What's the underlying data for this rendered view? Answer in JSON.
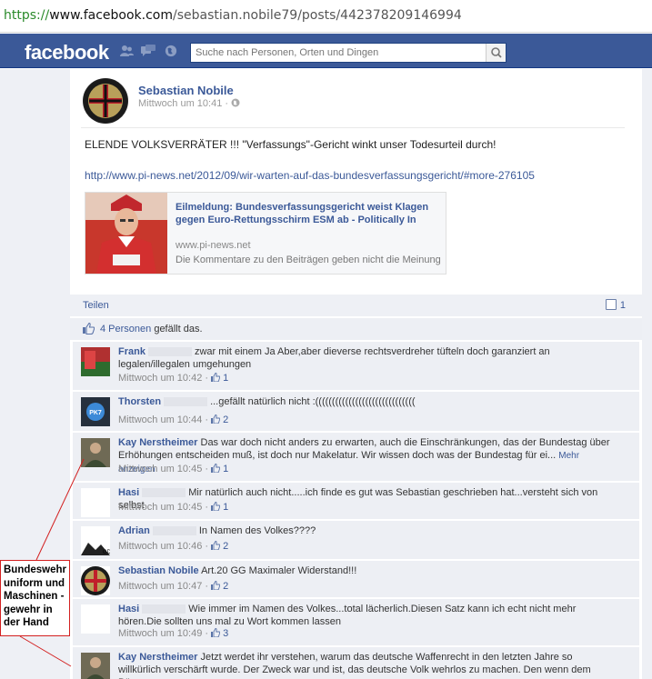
{
  "browser": {
    "url_protocol": "https://",
    "url_host": "www.facebook.com",
    "url_path": "/sebastian.nobile79/posts/442378209146994"
  },
  "header": {
    "logo": "facebook",
    "search_placeholder": "Suche nach Personen, Orten und Dingen",
    "icons": [
      "friends-icon",
      "messages-icon",
      "globe-icon",
      "search-icon"
    ]
  },
  "post": {
    "author": "Sebastian Nobile",
    "timestamp": "Mittwoch um 10:41",
    "meta_sep": "·",
    "message": "ELENDE VOLKSVERRÄTER !!! \"Verfassungs\"-Gericht winkt unser Todesurteil durch!",
    "link": "http://www.pi-news.net/2012/09/wir-warten-auf-das-bundesverfassungsgericht/#more-276105",
    "shared": {
      "title": "Eilmeldung: Bundesverfassungsgericht weist Klagen gegen Euro-Rettungsschirm ESM ab - Politically In",
      "domain": "www.pi-news.net",
      "description": "Die Kommentare zu den Beiträgen geben nicht die Meinung"
    },
    "share_action": "Teilen",
    "comment_count": "1",
    "likes": {
      "people": "4 Personen",
      "suffix": " gefällt das."
    }
  },
  "comments": [
    {
      "name": "Frank",
      "text": "zwar mit einem Ja Aber,aber dieverse rechtsverdreher tüfteln doch garanziert an legalen/illegalen umgehungen",
      "time": "Mittwoch um 10:42",
      "likes": "1"
    },
    {
      "name": "Thorsten",
      "text": "...gefällt natürlich nicht :((((((((((((((((((((((((((((((",
      "time": "Mittwoch um 10:44",
      "likes": "2"
    },
    {
      "name": "Kay Nerstheimer",
      "text": "Das war doch nicht anders zu erwarten, auch die Einschränkungen, das der Bundestag über Erhöhungen entscheiden muß, ist doch nur Makelatur. Wir wissen doch was der Bundestag für ei...",
      "more": "Mehr anzeigen",
      "time": "Mittwoch um 10:45",
      "likes": "1"
    },
    {
      "name": "Hasi",
      "text": "Mir natürlich auch nicht.....ich finde es gut was Sebastian geschrieben hat...versteht sich von selbst",
      "time": "Mittwoch um 10:45",
      "likes": "1"
    },
    {
      "name": "Adrian",
      "text": "In Namen des Volkes????",
      "time": "Mittwoch um 10:46",
      "likes": "2"
    },
    {
      "name": "Sebastian Nobile",
      "text": "Art.20 GG Maximaler Widerstand!!!",
      "time": "Mittwoch um 10:47",
      "likes": "2"
    },
    {
      "name": "Hasi",
      "text": "Wie immer im Namen des Volkes...total lächerlich.Diesen Satz kann ich echt nicht mehr hören.Die sollten uns mal zu Wort kommen lassen",
      "time": "Mittwoch um 10:49",
      "likes": "3"
    },
    {
      "name": "Kay Nerstheimer",
      "text": "Jetzt werdet ihr verstehen, warum das deutsche Waffenrecht in den letzten Jahre so willkürlich verschärft wurde. Der Zweck war und ist, das deutsche Volk wehrlos zu machen. Den wenn dem Bürger",
      "time": "",
      "likes": ""
    }
  ],
  "annotation": {
    "callout_text": "Bundeswehr uniform und Maschinen -gewehr in der Hand",
    "color": "#d32020"
  },
  "colors": {
    "brand": "#3b5998",
    "link": "#3b5998",
    "comment_bg": "#edeff4"
  }
}
